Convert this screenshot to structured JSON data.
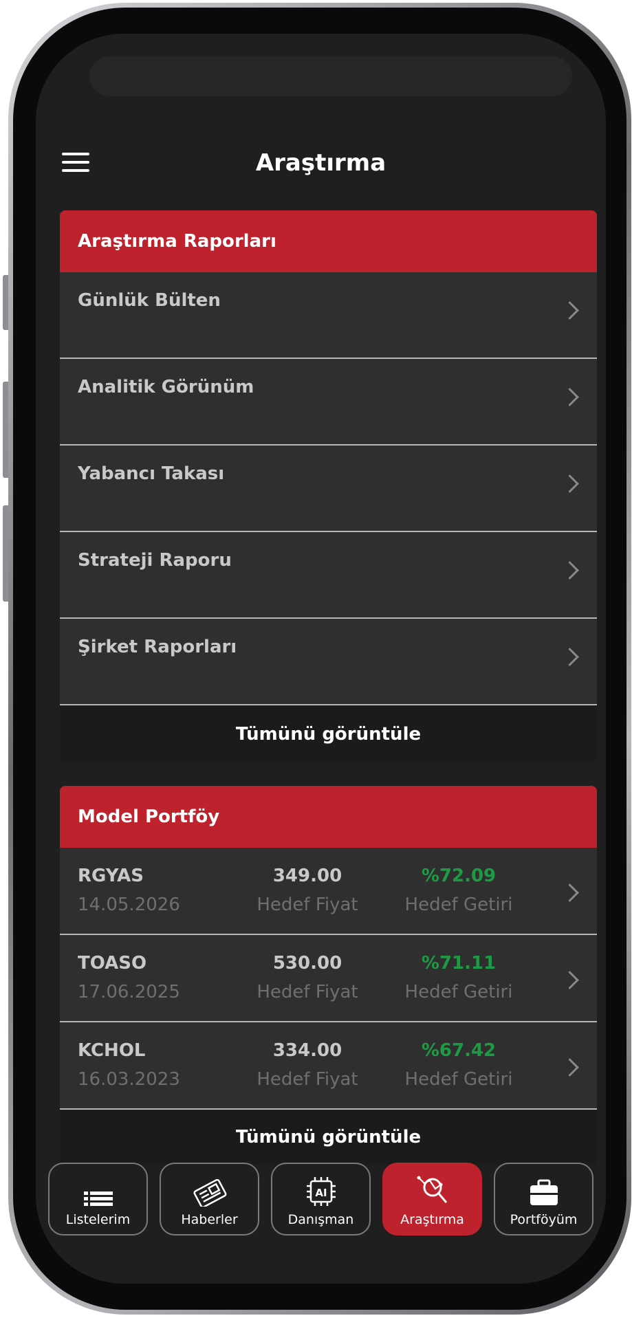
{
  "header": {
    "title": "Araştırma"
  },
  "reports": {
    "title": "Araştırma Raporları",
    "items": [
      {
        "label": "Günlük Bülten"
      },
      {
        "label": "Analitik Görünüm"
      },
      {
        "label": "Yabancı Takası"
      },
      {
        "label": "Strateji Raporu"
      },
      {
        "label": "Şirket Raporları"
      }
    ],
    "view_all": "Tümünü görüntüle"
  },
  "portfolio": {
    "title": "Model Portföy",
    "rows": [
      {
        "symbol": "RGYAS",
        "date": "14.05.2026",
        "target_price": "349.00",
        "target_price_label": "Hedef Fiyat",
        "target_return": "%72.09",
        "target_return_label": "Hedef Getiri"
      },
      {
        "symbol": "TOASO",
        "date": "17.06.2025",
        "target_price": "530.00",
        "target_price_label": "Hedef Fiyat",
        "target_return": "%71.11",
        "target_return_label": "Hedef Getiri"
      },
      {
        "symbol": "KCHOL",
        "date": "16.03.2023",
        "target_price": "334.00",
        "target_price_label": "Hedef Fiyat",
        "target_return": "%67.42",
        "target_return_label": "Hedef Getiri"
      }
    ],
    "view_all": "Tümünü görüntüle"
  },
  "tabs": [
    {
      "label": "Listelerim",
      "icon": "list-icon"
    },
    {
      "label": "Haberler",
      "icon": "newspaper-icon"
    },
    {
      "label": "Danışman",
      "icon": "ai-chip-icon",
      "chip_text": "AI"
    },
    {
      "label": "Araştırma",
      "icon": "research-magnifier-icon",
      "active": true
    },
    {
      "label": "Portföyüm",
      "icon": "briefcase-icon"
    }
  ],
  "colors": {
    "accent": "#bd222d",
    "positive": "#1e9a45",
    "background": "#1f1f1f",
    "card": "#2f2f2f"
  }
}
